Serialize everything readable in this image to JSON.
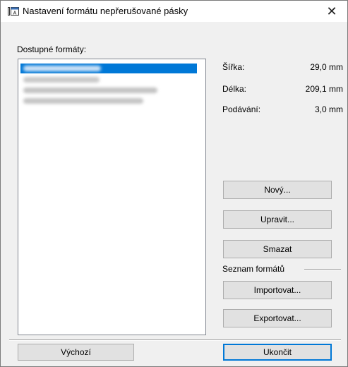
{
  "window": {
    "title": "Nastavení formátu nepřerušované pásky",
    "close_glyph": "✕"
  },
  "formats": {
    "label": "Dostupné formáty:",
    "items": [
      {
        "selected": true
      },
      {
        "selected": false
      },
      {
        "selected": false
      },
      {
        "selected": false
      }
    ]
  },
  "info": {
    "width_label": "Šířka:",
    "width_value": "29,0 mm",
    "length_label": "Délka:",
    "length_value": "209,1 mm",
    "feed_label": "Podávání:",
    "feed_value": "3,0 mm"
  },
  "buttons": {
    "new": "Nový...",
    "edit": "Upravit...",
    "delete": "Smazat",
    "import": "Importovat...",
    "export": "Exportovat...",
    "default": "Výchozí",
    "close": "Ukončit"
  },
  "group": {
    "label": "Seznam formátů"
  },
  "colors": {
    "selection": "#0078d7",
    "default_border": "#0078d7"
  }
}
